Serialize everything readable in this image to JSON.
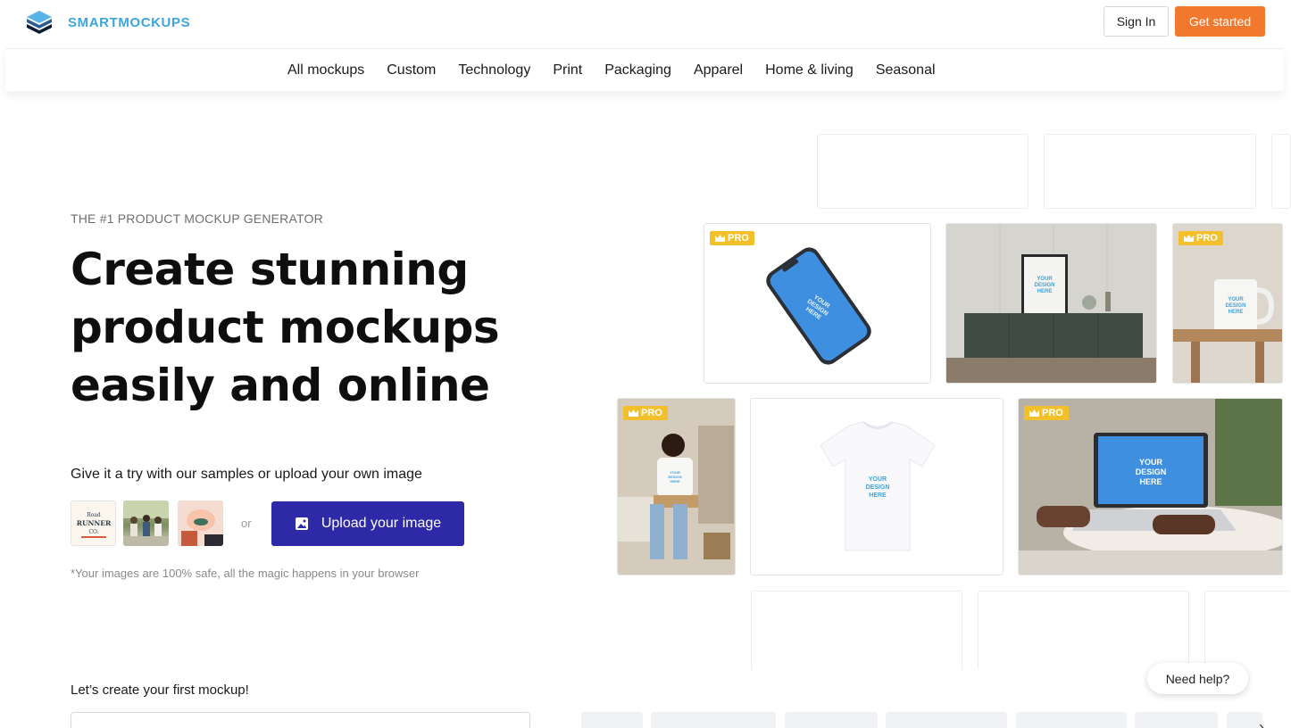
{
  "brand": {
    "name": "SMARTMOCKUPS",
    "accent": "#3ea4dc"
  },
  "header": {
    "sign_in": "Sign In",
    "get_started": "Get started",
    "get_started_color": "#f2782e"
  },
  "nav": {
    "items": [
      "All mockups",
      "Custom",
      "Technology",
      "Print",
      "Packaging",
      "Apparel",
      "Home & living",
      "Seasonal"
    ]
  },
  "hero": {
    "eyebrow": "THE #1 PRODUCT MOCKUP GENERATOR",
    "title": "Create stunning product mockups easily and online",
    "try_text": "Give it a try with our samples or upload your own image",
    "samples": [
      {
        "label": "Road RUNNER Co."
      },
      {
        "label": ""
      },
      {
        "label": ""
      }
    ],
    "or": "or",
    "upload_button": "Upload your image",
    "upload_color": "#2d29a7",
    "safe_note": "*Your images are 100% safe, all the magic happens in your browser",
    "first_mockup": "Let’s create your first mockup!"
  },
  "gallery": {
    "pro_label": "PRO",
    "design_label": "YOUR DESIGN HERE",
    "pro_color": "#f3c02c"
  },
  "help": {
    "label": "Need help?"
  },
  "icons": {
    "logo": "smartmockups-logo-icon",
    "upload": "image-upload-icon",
    "crown": "crown-icon",
    "arrow": "chevron-right-icon"
  }
}
